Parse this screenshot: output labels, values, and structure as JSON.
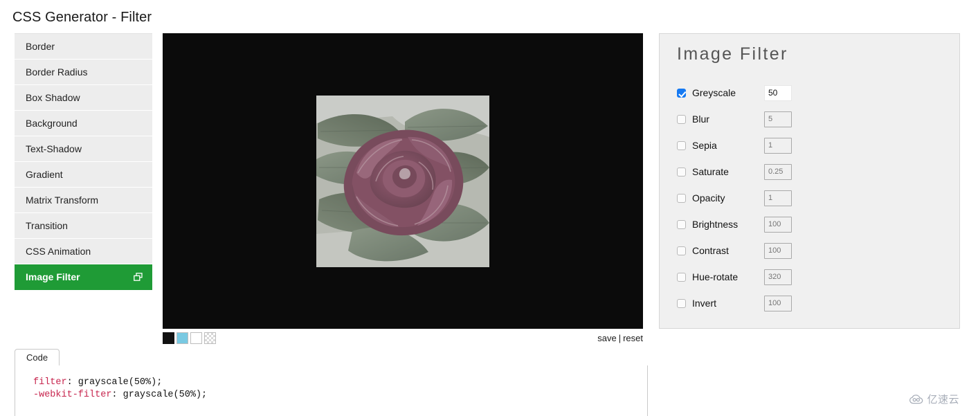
{
  "page": {
    "title": "CSS Generator - Filter"
  },
  "sidebar": {
    "items": [
      {
        "label": "Border",
        "active": false
      },
      {
        "label": "Border Radius",
        "active": false
      },
      {
        "label": "Box Shadow",
        "active": false
      },
      {
        "label": "Background",
        "active": false
      },
      {
        "label": "Text-Shadow",
        "active": false
      },
      {
        "label": "Gradient",
        "active": false
      },
      {
        "label": "Matrix Transform",
        "active": false
      },
      {
        "label": "Transition",
        "active": false
      },
      {
        "label": "CSS Animation",
        "active": false
      },
      {
        "label": "Image Filter",
        "active": true,
        "icon": "windows-copy-icon"
      }
    ],
    "active_accent": "#1f9b36"
  },
  "preview": {
    "background_color": "#0b0b0b",
    "image_alt": "dark red rose with green leaves",
    "applied_filter": "grayscale(50%)",
    "swatches": [
      {
        "name": "black-swatch",
        "color": "#111111",
        "selected": true
      },
      {
        "name": "blue-swatch",
        "color": "#79c9e2",
        "selected": false
      },
      {
        "name": "white-swatch",
        "color": "#ffffff",
        "selected": false
      },
      {
        "name": "transparent-swatch",
        "color": "transparent",
        "selected": false
      }
    ],
    "actions": {
      "save_label": "save",
      "separator": "|",
      "reset_label": "reset"
    }
  },
  "filter_panel": {
    "title": "Image Filter",
    "rows": [
      {
        "name": "greyscale",
        "label": "Greyscale",
        "checked": true,
        "value": "50",
        "placeholder": "50"
      },
      {
        "name": "blur",
        "label": "Blur",
        "checked": false,
        "value": "",
        "placeholder": "5"
      },
      {
        "name": "sepia",
        "label": "Sepia",
        "checked": false,
        "value": "",
        "placeholder": "1"
      },
      {
        "name": "saturate",
        "label": "Saturate",
        "checked": false,
        "value": "",
        "placeholder": "0.25"
      },
      {
        "name": "opacity",
        "label": "Opacity",
        "checked": false,
        "value": "",
        "placeholder": "1"
      },
      {
        "name": "brightness",
        "label": "Brightness",
        "checked": false,
        "value": "",
        "placeholder": "100"
      },
      {
        "name": "contrast",
        "label": "Contrast",
        "checked": false,
        "value": "",
        "placeholder": "100"
      },
      {
        "name": "hue-rotate",
        "label": "Hue-rotate",
        "checked": false,
        "value": "",
        "placeholder": "320"
      },
      {
        "name": "invert",
        "label": "Invert",
        "checked": false,
        "value": "",
        "placeholder": "100"
      }
    ],
    "checked_color": "#1579f2"
  },
  "code_panel": {
    "tab_label": "Code",
    "lines": [
      {
        "property": "filter",
        "rest": ": grayscale(50%);"
      },
      {
        "property": "-webkit-filter",
        "rest": ": grayscale(50%);"
      }
    ]
  },
  "watermark": {
    "text": "亿速云",
    "icon": "cloud-icon"
  }
}
